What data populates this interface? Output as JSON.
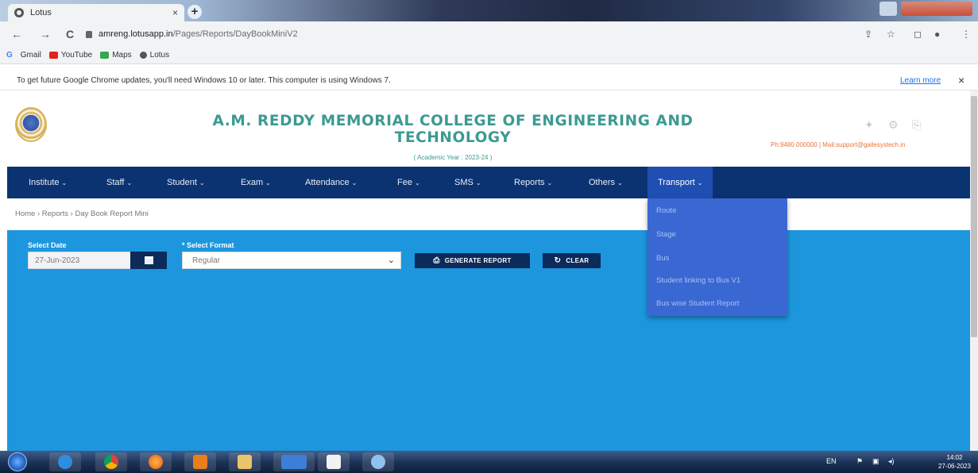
{
  "browser": {
    "tab_title": "Lotus",
    "tab_close": "×",
    "new_tab": "+",
    "url_host": "amreng.lotusapp.in",
    "url_path": "/Pages/Reports/DayBookMiniV2",
    "nav_back": "←",
    "nav_forward": "→",
    "nav_reload": "C",
    "bookmarks": [
      {
        "label": "Gmail",
        "color": "#4285f4"
      },
      {
        "label": "YouTube",
        "color": "#e62117"
      },
      {
        "label": "Maps",
        "color": "#34a853"
      },
      {
        "label": "Lotus",
        "color": "#555555"
      }
    ],
    "info_message": "To get future Google Chrome updates, you'll need Windows 10 or later. This computer is using Windows 7.",
    "learn_more": "Learn more",
    "info_close": "×"
  },
  "header": {
    "college_name": "A.M. REDDY MEMORIAL COLLEGE OF ENGINEERING AND TECHNOLOGY",
    "academic_year": "( Academic Year : 2023-24 )",
    "contact": "Ph:9480 000000 | Mail:support@gailesystech.in",
    "title_color": "#3c9a91"
  },
  "nav": {
    "items": [
      {
        "label": "Institute",
        "caret": "⌄"
      },
      {
        "label": "Staff",
        "caret": "⌄"
      },
      {
        "label": "Student",
        "caret": "⌄"
      },
      {
        "label": "Exam",
        "caret": "⌄"
      },
      {
        "label": "Attendance",
        "caret": "⌄"
      },
      {
        "label": "Fee",
        "caret": "⌄"
      },
      {
        "label": "SMS",
        "caret": "⌄"
      },
      {
        "label": "Reports",
        "caret": "⌄"
      },
      {
        "label": "Others",
        "caret": "⌄"
      },
      {
        "label": "Transport",
        "caret": "⌄"
      }
    ],
    "transport_menu": [
      "Route",
      "Stage",
      "Bus",
      "Student linking to Bus V1",
      "Bus wise Student Report"
    ],
    "nav_color": "#0c3371"
  },
  "breadcrumb": "Home › Reports › Day Book Report Mini",
  "form": {
    "date_label": "Select Date",
    "date_value": "27-Jun-2023",
    "format_label": "* Select Format",
    "format_value": "Regular",
    "generate_label": "GENERATE REPORT",
    "clear_label": "CLEAR",
    "panel_color": "#1d96de"
  },
  "taskbar": {
    "lang": "EN",
    "time": "14:02",
    "date": "27-06-2023"
  }
}
